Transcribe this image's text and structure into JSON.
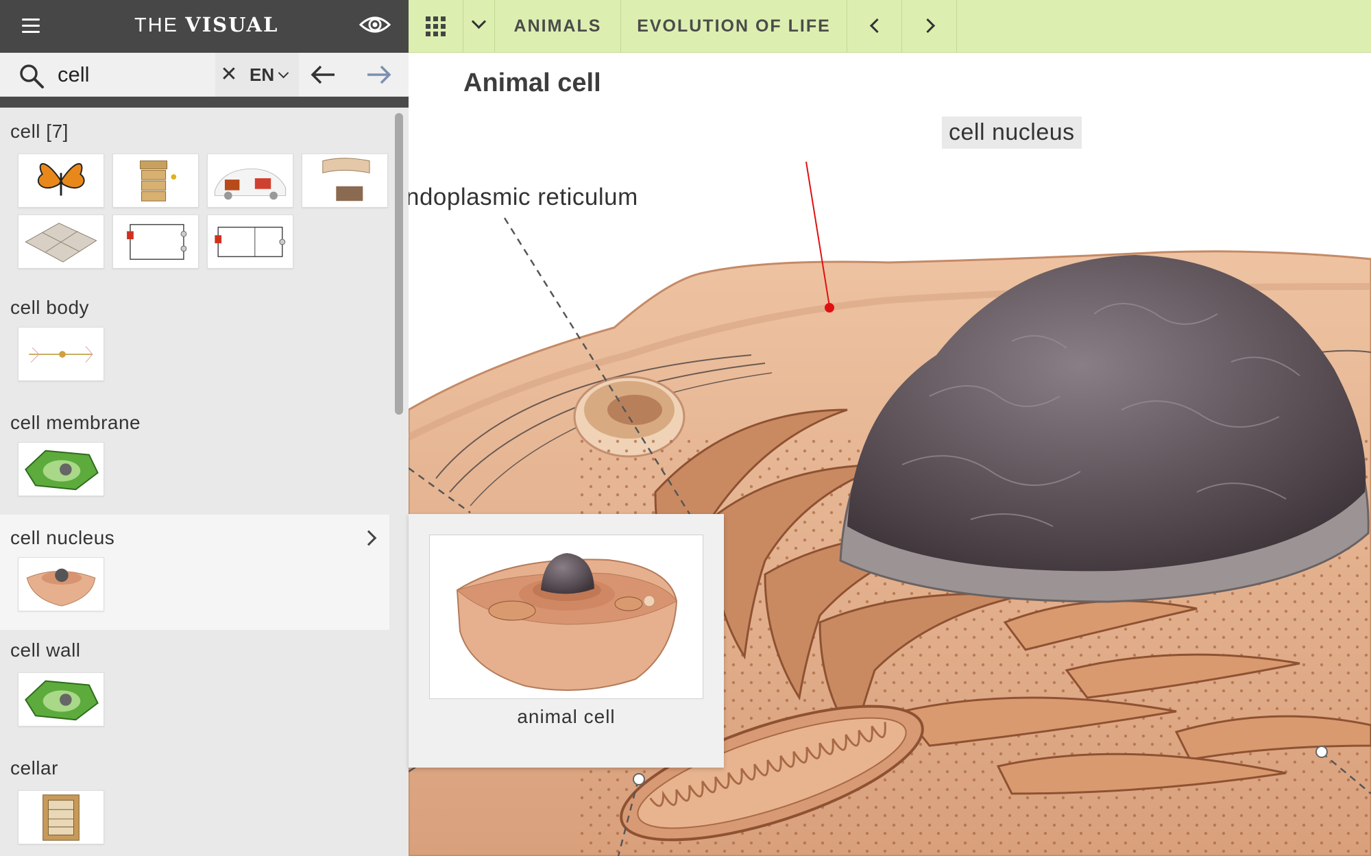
{
  "brand": {
    "prefix": "THE",
    "name": "VISUAL"
  },
  "search": {
    "value": "cell",
    "placeholder": "",
    "language": "EN"
  },
  "results": [
    {
      "label": "cell [7]",
      "thumbs": [
        "monarch-butterfly",
        "beehive",
        "car-battery-system",
        "cross-section",
        "house-floorplan",
        "electric-circuit",
        "electric-circuit-2"
      ]
    },
    {
      "label": "cell body",
      "thumbs": [
        "neuron"
      ]
    },
    {
      "label": "cell membrane",
      "thumbs": [
        "plant-cell"
      ]
    },
    {
      "label": "cell nucleus",
      "thumbs": [
        "animal-cell"
      ],
      "active": true
    },
    {
      "label": "cell wall",
      "thumbs": [
        "plant-cell"
      ]
    },
    {
      "label": "cellar",
      "thumbs": [
        "wine-cellar"
      ]
    }
  ],
  "nav": {
    "categories": [
      "ANIMALS",
      "EVOLUTION OF LIFE"
    ]
  },
  "main": {
    "title": "Animal cell",
    "labels": {
      "nucleus": "cell nucleus",
      "er": "ndoplasmic reticulum"
    }
  },
  "popup": {
    "caption": "animal cell"
  },
  "colors": {
    "sidebar_bg": "#e9e9e9",
    "brand_bar": "#474747",
    "nav_bg": "#dcefb0",
    "nucleus": "#5d5258",
    "cytoplasm": "#e8b894",
    "er": "#c98a62",
    "pointer_red": "#e01010"
  }
}
